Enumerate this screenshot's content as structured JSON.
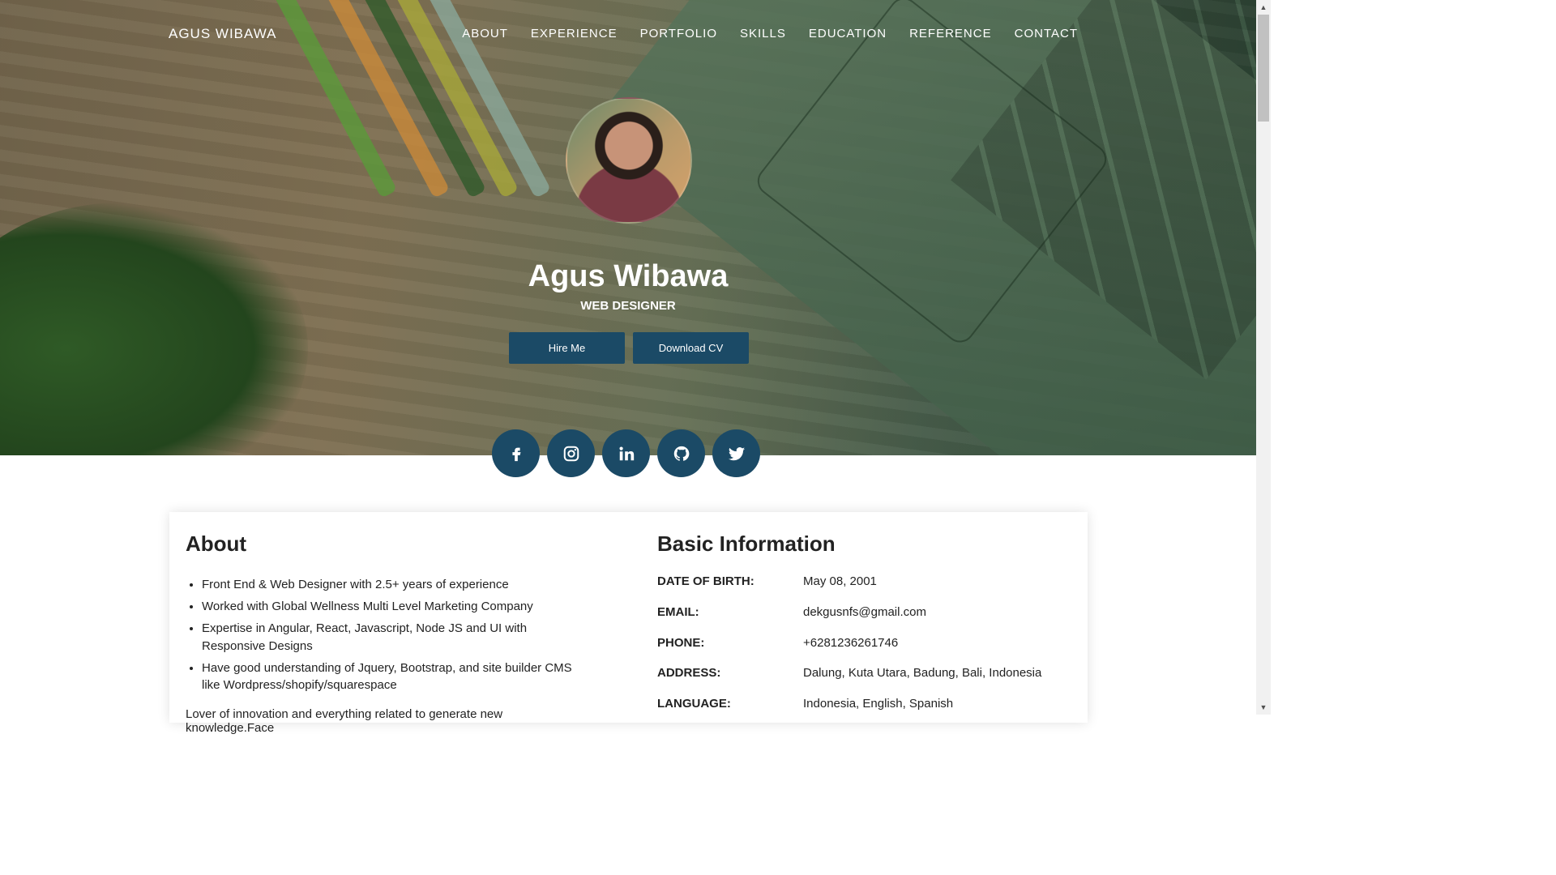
{
  "nav": {
    "brand": "AGUS WIBAWA",
    "items": [
      "ABOUT",
      "EXPERIENCE",
      "PORTFOLIO",
      "SKILLS",
      "EDUCATION",
      "REFERENCE",
      "CONTACT"
    ]
  },
  "profile": {
    "name": "Agus Wibawa",
    "title": "WEB DESIGNER",
    "hire_label": "Hire Me",
    "cv_label": "Download CV"
  },
  "socials": [
    "facebook-icon",
    "instagram-icon",
    "linkedin-icon",
    "github-icon",
    "twitter-icon"
  ],
  "about": {
    "heading": "About",
    "bullets": [
      "Front End & Web Designer with 2.5+ years of experience",
      "Worked with Global Wellness Multi Level Marketing Company",
      "Expertise in Angular, React, Javascript, Node JS and UI with Responsive Designs",
      "Have good understanding of Jquery, Bootstrap, and site builder CMS like Wordpress/shopify/squarespace"
    ],
    "paragraph": "Lover of innovation and everything related to generate new knowledge.Face"
  },
  "basic": {
    "heading": "Basic Information",
    "rows": [
      {
        "label": "DATE OF BIRTH:",
        "value": "May 08, 2001"
      },
      {
        "label": "EMAIL:",
        "value": "dekgusnfs@gmail.com"
      },
      {
        "label": "PHONE:",
        "value": "+6281236261746"
      },
      {
        "label": "ADDRESS:",
        "value": "Dalung, Kuta Utara, Badung, Bali, Indonesia"
      },
      {
        "label": "LANGUAGE:",
        "value": "Indonesia, English, Spanish"
      }
    ]
  },
  "colors": {
    "accent": "#1b4a66"
  }
}
